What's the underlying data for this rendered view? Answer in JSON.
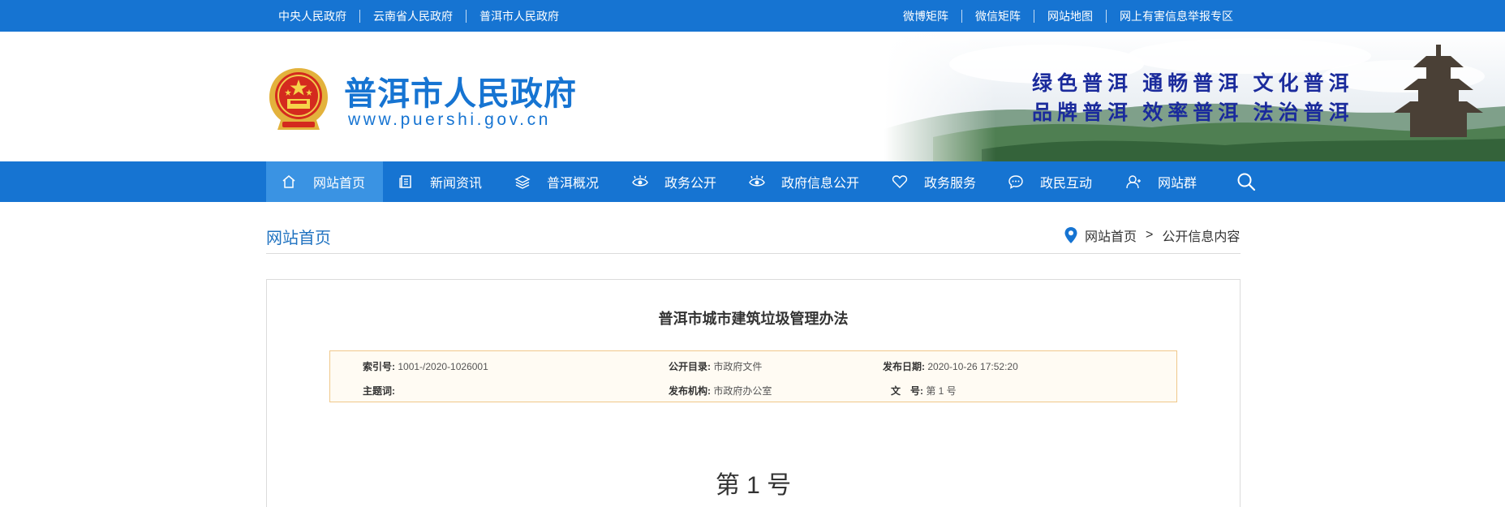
{
  "topbar": {
    "left_links": [
      "中央人民政府",
      "云南省人民政府",
      "普洱市人民政府"
    ],
    "right_links": [
      "微博矩阵",
      "微信矩阵",
      "网站地图",
      "网上有害信息举报专区"
    ]
  },
  "header": {
    "title": "普洱市人民政府",
    "url": "www.puershi.gov.cn",
    "slogan_line1": "绿色普洱  通畅普洱  文化普洱",
    "slogan_line2": "品牌普洱  效率普洱  法治普洱"
  },
  "nav": {
    "items": [
      {
        "label": "网站首页",
        "icon": "home-icon",
        "active": true
      },
      {
        "label": "新闻资讯",
        "icon": "news-icon"
      },
      {
        "label": "普洱概况",
        "icon": "layers-icon"
      },
      {
        "label": "政务公开",
        "icon": "eye-icon"
      },
      {
        "label": "政府信息公开",
        "icon": "eye-icon"
      },
      {
        "label": "政务服务",
        "icon": "heart-icon"
      },
      {
        "label": "政民互动",
        "icon": "chat-icon"
      },
      {
        "label": "网站群",
        "icon": "user-icon"
      }
    ],
    "search_icon": "search-icon"
  },
  "page": {
    "section_title": "网站首页",
    "breadcrumb": [
      "网站首页",
      "公开信息内容"
    ],
    "breadcrumb_sep": ">"
  },
  "document": {
    "title": "普洱市城市建筑垃圾管理办法",
    "meta": {
      "index_label": "索引号:",
      "index_value": "1001-/2020-1026001",
      "catalog_label": "公开目录:",
      "catalog_value": "市政府文件",
      "date_label": "发布日期:",
      "date_value": "2020-10-26 17:52:20",
      "keyword_label": "主题词:",
      "keyword_value": "",
      "org_label": "发布机构:",
      "org_value": "市政府办公室",
      "docno_label": "文　号:",
      "docno_value": "第 1 号"
    },
    "number_heading": "第 1 号"
  },
  "colors": {
    "brand_blue": "#1674d2",
    "nav_active": "#3a93e3",
    "meta_border": "#f0c88a",
    "slogan": "#1b2b9c"
  }
}
